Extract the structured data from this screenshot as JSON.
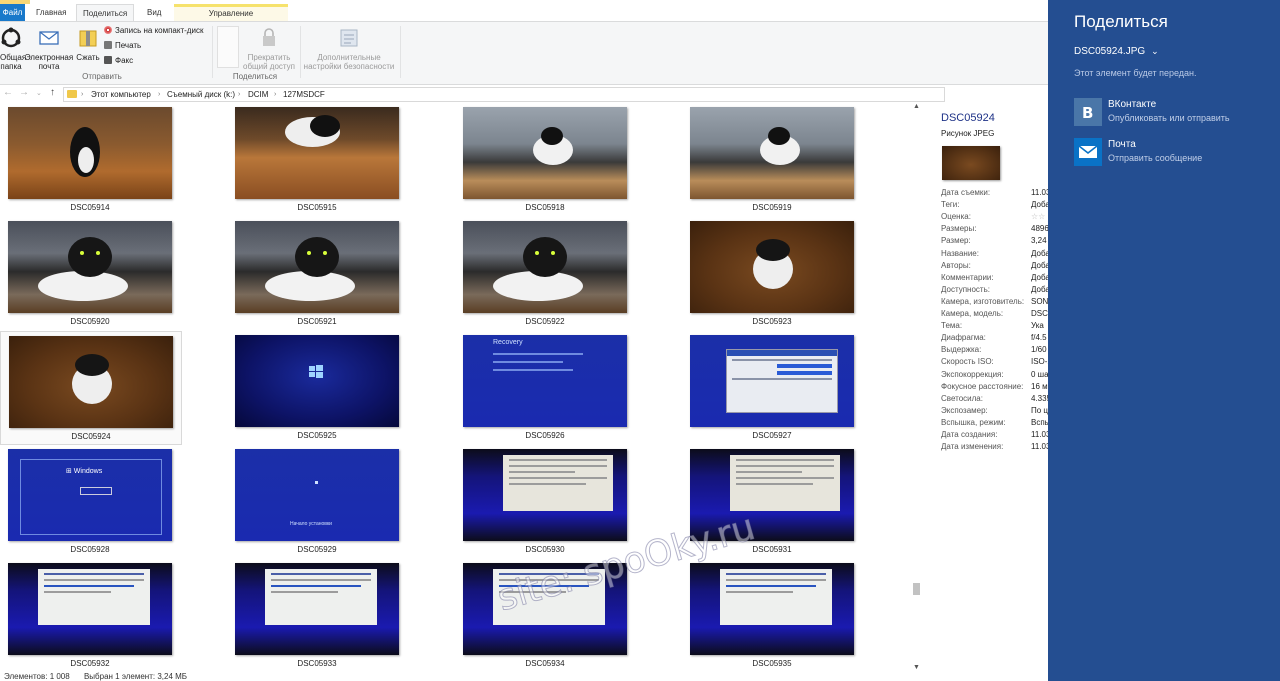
{
  "ribbon": {
    "tabs": {
      "file": "Файл",
      "home": "Главная",
      "share": "Поделиться",
      "view": "Вид",
      "manage": "Управление"
    },
    "buttons": {
      "share_folder": "Общая папка",
      "email": "Электронная почта",
      "zip": "Сжать",
      "burn": "Запись на компакт-диск",
      "print": "Печать",
      "fax": "Факс",
      "stop_sharing": "Прекратить общий доступ",
      "advanced_security": "Дополнительные настройки безопасности"
    },
    "groups": {
      "send": "Отправить",
      "share_with": "Поделиться"
    }
  },
  "address": {
    "crumbs": [
      "Этот компьютер",
      "Съемный диск (k:)",
      "DCIM",
      "127MSDCF"
    ]
  },
  "files": [
    {
      "name": "DSC05914",
      "scene": "floor"
    },
    {
      "name": "DSC05915",
      "scene": "floor2"
    },
    {
      "name": "DSC05918",
      "scene": "skate"
    },
    {
      "name": "DSC05919",
      "scene": "skate"
    },
    {
      "name": "DSC05920",
      "scene": "cat"
    },
    {
      "name": "DSC05921",
      "scene": "cat"
    },
    {
      "name": "DSC05922",
      "scene": "cat"
    },
    {
      "name": "DSC05923",
      "scene": "wood"
    },
    {
      "name": "DSC05924",
      "scene": "wood",
      "selected": true
    },
    {
      "name": "DSC05925",
      "scene": "boot"
    },
    {
      "name": "DSC05926",
      "scene": "recovery"
    },
    {
      "name": "DSC05927",
      "scene": "setup"
    },
    {
      "name": "DSC05928",
      "scene": "installnow"
    },
    {
      "name": "DSC05929",
      "scene": "installing"
    },
    {
      "name": "DSC05930",
      "scene": "license"
    },
    {
      "name": "DSC05931",
      "scene": "license"
    },
    {
      "name": "DSC05932",
      "scene": "partition"
    },
    {
      "name": "DSC05933",
      "scene": "partition"
    },
    {
      "name": "DSC05934",
      "scene": "partition"
    },
    {
      "name": "DSC05935",
      "scene": "partition"
    }
  ],
  "thumb_text": {
    "recovery": "Recovery",
    "windows": "Windows",
    "installing": "Начало установки"
  },
  "details": {
    "name": "DSC05924",
    "type": "Рисунок JPEG",
    "props": [
      {
        "label": "Дата съемки:",
        "value": "11.03"
      },
      {
        "label": "Теги:",
        "value": "Доба"
      },
      {
        "label": "Оценка:",
        "value": "☆☆"
      },
      {
        "label": "Размеры:",
        "value": "4896"
      },
      {
        "label": "Размер:",
        "value": "3,24"
      },
      {
        "label": "Название:",
        "value": "Доба"
      },
      {
        "label": "Авторы:",
        "value": "Доба"
      },
      {
        "label": "Комментарии:",
        "value": "Доба"
      },
      {
        "label": "Доступность:",
        "value": "Доба"
      },
      {
        "label": "Камера, изготовитель:",
        "value": "SONY"
      },
      {
        "label": "Камера, модель:",
        "value": "DSC-"
      },
      {
        "label": "Тема:",
        "value": "Ука"
      },
      {
        "label": "Диафрагма:",
        "value": "f/4.5"
      },
      {
        "label": "Выдержка:",
        "value": "1/60"
      },
      {
        "label": "Скорость ISO:",
        "value": "ISO-2"
      },
      {
        "label": "Экспокоррекция:",
        "value": "0 ша"
      },
      {
        "label": "Фокусное расстояние:",
        "value": "16 м"
      },
      {
        "label": "Светосила:",
        "value": "4.335"
      },
      {
        "label": "Экспозамер:",
        "value": "По ц"
      },
      {
        "label": "Вспышка, режим:",
        "value": "Вспы"
      },
      {
        "label": "Дата создания:",
        "value": "11.03"
      },
      {
        "label": "Дата изменения:",
        "value": "11.03"
      }
    ]
  },
  "status": {
    "count": "Элементов: 1 008",
    "selection": "Выбран 1 элемент: 3,24 МБ"
  },
  "watermark": "site: spoOky.ru",
  "share_charm": {
    "title": "Поделиться",
    "file": "DSC05924.JPG",
    "subtitle": "Этот элемент будет передан.",
    "targets": [
      {
        "name": "ВКонтакте",
        "desc": "Опубликовать или отправить",
        "icon": "vk-icon",
        "color": "#4a76a8"
      },
      {
        "name": "Почта",
        "desc": "Отправить сообщение",
        "icon": "mail-icon",
        "color": "#0a72c6"
      }
    ]
  }
}
